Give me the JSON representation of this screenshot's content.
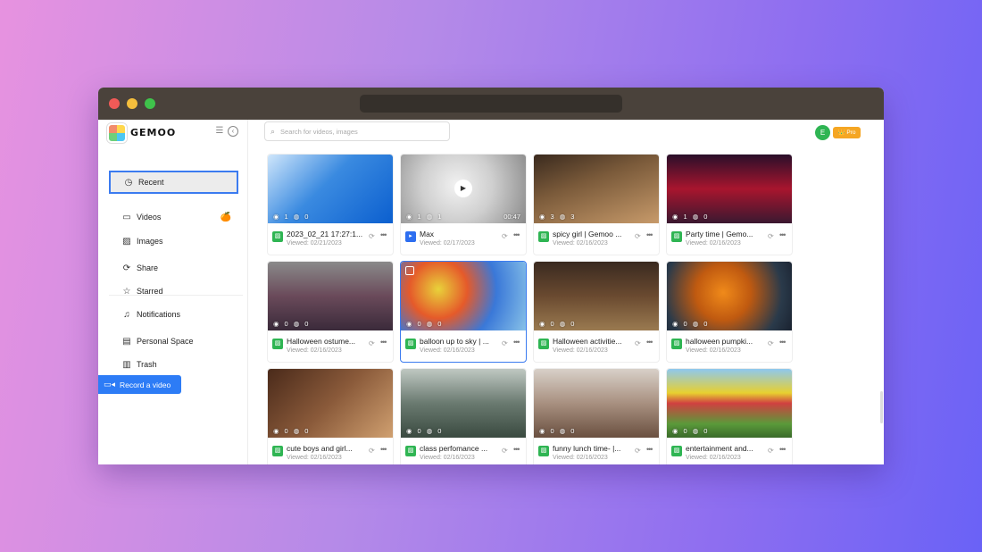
{
  "window": {
    "colors": {
      "titlebar": "#4a423b",
      "accent": "#2d7cf6",
      "file_green": "#2fb553"
    }
  },
  "brand": {
    "name": "GEMOO"
  },
  "sidebar": {
    "items": [
      {
        "label": "Recent",
        "icon": "clock-icon",
        "active": true
      },
      {
        "label": "Videos",
        "icon": "video-icon",
        "badge": "🍊"
      },
      {
        "label": "Images",
        "icon": "image-icon"
      },
      {
        "label": "Share",
        "icon": "share-icon"
      },
      {
        "label": "Starred",
        "icon": "star-icon"
      },
      {
        "label": "Notifications",
        "icon": "bell-icon"
      },
      {
        "label": "Personal Space",
        "icon": "folder-icon"
      },
      {
        "label": "Trash",
        "icon": "trash-icon"
      }
    ],
    "record_label": "Record a video"
  },
  "search": {
    "placeholder": "Search for videos, images"
  },
  "header": {
    "avatar_letter": "E",
    "pro_label": "Pro"
  },
  "cards": [
    {
      "title": "2023_02_21 17:27:1...",
      "viewed": "Viewed: 02/21/2023",
      "views": "1",
      "comments": "0",
      "type": "image",
      "thumb_bg": "linear-gradient(135deg,#cfe6fb 0%,#3a8ae0 45%,#0b5fcf 100%)"
    },
    {
      "title": "Max",
      "viewed": "Viewed: 02/17/2023",
      "views": "1",
      "comments": "1",
      "type": "video",
      "duration": "00:47",
      "thumb_bg": "radial-gradient(circle at 45% 45%,#f2f2f2 0%,#cfcfcf 45%,#8a8a8a 100%)"
    },
    {
      "title": "spicy girl | Gemoo ...",
      "viewed": "Viewed: 02/16/2023",
      "views": "3",
      "comments": "3",
      "type": "image",
      "thumb_bg": "linear-gradient(160deg,#3a2a1e 0%,#7a5a3a 40%,#c79a6a 100%)"
    },
    {
      "title": "Party time | Gemo...",
      "viewed": "Viewed: 02/16/2023",
      "views": "1",
      "comments": "0",
      "type": "image",
      "thumb_bg": "linear-gradient(180deg,#2a0f2a 0%,#a8152e 50%,#3a1830 100%)"
    },
    {
      "title": "Halloween ostume...",
      "viewed": "Viewed: 02/16/2023",
      "views": "0",
      "comments": "0",
      "type": "image",
      "thumb_bg": "linear-gradient(180deg,#8a8a8a 0%,#6a4a5a 50%,#3a2a3a 100%)"
    },
    {
      "title": "balloon up to sky | ...",
      "viewed": "Viewed: 02/16/2023",
      "views": "0",
      "comments": "0",
      "type": "image",
      "selected": true,
      "thumb_bg": "radial-gradient(circle at 30% 40%,#e8d23a 0%,#e55a2a 30%,#3a78d8 60%,#88c2e8 100%)"
    },
    {
      "title": "Halloween activitie...",
      "viewed": "Viewed: 02/16/2023",
      "views": "0",
      "comments": "0",
      "type": "image",
      "thumb_bg": "linear-gradient(180deg,#3a2a20 0%,#6a4a30 50%,#9a7a50 100%)"
    },
    {
      "title": "halloween pumpki...",
      "viewed": "Viewed: 02/16/2023",
      "views": "0",
      "comments": "0",
      "type": "image",
      "thumb_bg": "radial-gradient(circle at 45% 45%,#f08a1a 0%,#c05a10 35%,#2a3a4a 75%,#1a2230 100%)"
    },
    {
      "title": "cute boys and girl...",
      "viewed": "Viewed: 02/16/2023",
      "views": "0",
      "comments": "0",
      "type": "image",
      "thumb_bg": "linear-gradient(135deg,#4a2a1a 0%,#8a5a3a 50%,#d0a070 100%)"
    },
    {
      "title": "class perfomance ...",
      "viewed": "Viewed: 02/16/2023",
      "views": "0",
      "comments": "0",
      "type": "image",
      "thumb_bg": "linear-gradient(180deg,#bfc8c2 0%,#6a7a70 50%,#3a4a40 100%)"
    },
    {
      "title": "funny lunch time- |...",
      "viewed": "Viewed: 02/16/2023",
      "views": "0",
      "comments": "0",
      "type": "image",
      "thumb_bg": "linear-gradient(180deg,#d8d0c8 0%,#a89080 50%,#6a5040 100%)"
    },
    {
      "title": "entertainment and...",
      "viewed": "Viewed: 02/16/2023",
      "views": "0",
      "comments": "0",
      "type": "image",
      "thumb_bg": "linear-gradient(180deg,#8ec8ee 0%,#e8d030 35%,#d04040 50%,#5a9a3a 80%,#3a6a2a 100%)"
    }
  ]
}
